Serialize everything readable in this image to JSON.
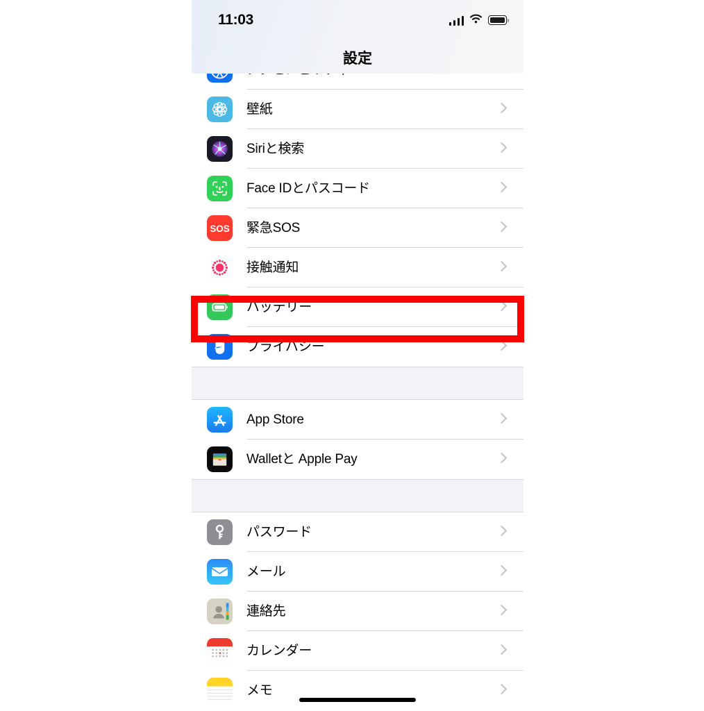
{
  "status_bar": {
    "time": "11:03",
    "signal_icon": "cellular-signal-icon",
    "wifi_icon": "wifi-icon",
    "battery_icon": "battery-full-icon"
  },
  "nav": {
    "title": "設定"
  },
  "highlight": {
    "color": "#ff0000",
    "target_row": "バッテリー"
  },
  "home_indicator": "home-indicator",
  "sections": [
    {
      "rows": [
        {
          "label": "アクセシビリティ",
          "icon": "accessibility-icon",
          "icon_color": "#1170ef",
          "chevron": "chevron-right-icon"
        },
        {
          "label": "壁紙",
          "icon": "wallpaper-icon",
          "icon_color": "#4cb8e5",
          "chevron": "chevron-right-icon"
        },
        {
          "label": "Siriと検索",
          "icon": "siri-icon",
          "icon_color": "#1c1c2e",
          "chevron": "chevron-right-icon"
        },
        {
          "label": "Face IDとパスコード",
          "icon": "face-id-icon",
          "icon_color": "#31d158",
          "chevron": "chevron-right-icon"
        },
        {
          "label": "緊急SOS",
          "icon": "emergency-sos-icon",
          "icon_color": "#ff3b30",
          "chevron": "chevron-right-icon"
        },
        {
          "label": "接触通知",
          "icon": "exposure-notification-icon",
          "icon_color": "#f8346a",
          "chevron": "chevron-right-icon"
        },
        {
          "label": "バッテリー",
          "icon": "battery-settings-icon",
          "icon_color": "#34c759",
          "chevron": "chevron-right-icon"
        },
        {
          "label": "プライバシー",
          "icon": "privacy-hand-icon",
          "icon_color": "#1170ef",
          "chevron": "chevron-right-icon"
        }
      ]
    },
    {
      "rows": [
        {
          "label": "App Store",
          "icon": "app-store-icon",
          "icon_color": "#1b9df5",
          "chevron": "chevron-right-icon"
        },
        {
          "label": "Walletと Apple Pay",
          "icon": "wallet-icon",
          "icon_color": "#000000",
          "chevron": "chevron-right-icon"
        }
      ]
    },
    {
      "rows": [
        {
          "label": "パスワード",
          "icon": "passwords-key-icon",
          "icon_color": "#8e8e93",
          "chevron": "chevron-right-icon"
        },
        {
          "label": "メール",
          "icon": "mail-icon",
          "icon_color": "#1b9df5",
          "chevron": "chevron-right-icon"
        },
        {
          "label": "連絡先",
          "icon": "contacts-icon",
          "icon_color": "#d6d2c4",
          "chevron": "chevron-right-icon"
        },
        {
          "label": "カレンダー",
          "icon": "calendar-icon",
          "icon_color": "#ffffff",
          "chevron": "chevron-right-icon"
        },
        {
          "label": "メモ",
          "icon": "notes-icon",
          "icon_color": "#ffd426",
          "chevron": "chevron-right-icon"
        }
      ]
    }
  ]
}
